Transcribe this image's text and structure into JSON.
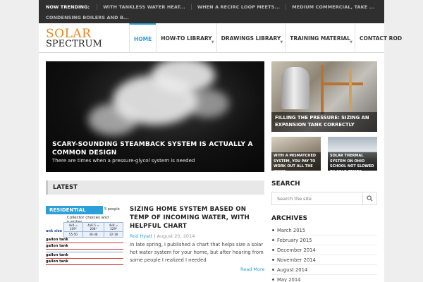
{
  "trending": {
    "label": "NOW TRENDING:",
    "items": [
      "WITH TANKLESS WATER HEAT...",
      "WHEN A RECIRC LOOP MEETS...",
      "MEDIUM COMMERCIAL, TAKE ...",
      "CONDENSING BOILERS AND B..."
    ]
  },
  "logo": {
    "line1": "SOLAR",
    "line2": "SPECTRUM"
  },
  "nav": {
    "items": [
      {
        "label": "HOME"
      },
      {
        "label": "HOW-TO LIBRARY"
      },
      {
        "label": "DRAWINGS LIBRARY"
      },
      {
        "label": "TRAINING MATERIAL"
      },
      {
        "label": "CONTACT ROD"
      }
    ]
  },
  "hero": {
    "title": "SCARY-SOUNDING STEAMBACK SYSTEM IS ACTUALLY A COMMON DESIGN",
    "subtitle": "There are times when a pressure-glycol system is needed"
  },
  "featured": [
    {
      "title": "FILLING THE PRESSURE: SIZING AN EXPANSION TANK CORRECTLY"
    },
    {
      "title": "WITH A MISMATCHED SYSTEM, YOU PAY TO WORK OUT ALL THE KINKS"
    },
    {
      "title": "SOLAR THERMAL SYSTEM ON OHIO SCHOOL NOT SLOWED BY COLD TEMPS"
    }
  ],
  "latest": {
    "heading": "LATEST",
    "post": {
      "thumb_badge": "RESIDENTIAL SOLAR",
      "thumb_tag": "5 people",
      "thumb_heading": "Collector choices and number",
      "thumb_row_label": "ank size",
      "thumb_cells": [
        "4x4 = 109*",
        "4x6.5 = 208*",
        "4x8 = 329*",
        "55-50",
        "36-38",
        "32-18"
      ],
      "thumb_lines": [
        "gallon tank",
        "gallon tank",
        "gallon tank",
        "gallon tank"
      ],
      "title": "SIZING HOME SYSTEM BASED ON TEMP OF INCOMING WATER, WITH HELPFUL CHART",
      "author": "Rod Hyatt",
      "separator": "|",
      "date": "August 20, 2014",
      "excerpt": "In late spring, I published a chart that helps size a solar hot water system for your home, but after hearing from some people I realized I needed",
      "read_more": "Read More"
    }
  },
  "search": {
    "heading": "SEARCH",
    "placeholder": "Search the site"
  },
  "archives": {
    "heading": "ARCHIVES",
    "items": [
      "March 2015",
      "February 2015",
      "December 2014",
      "November 2014",
      "August 2014",
      "May 2014"
    ]
  },
  "colors": {
    "accent": "#2b9fd9",
    "logo_orange": "#e8861b",
    "topbar": "#2f2f2f"
  },
  "icons": {
    "search": "search-icon",
    "dropdown": "chevron-down-icon"
  }
}
